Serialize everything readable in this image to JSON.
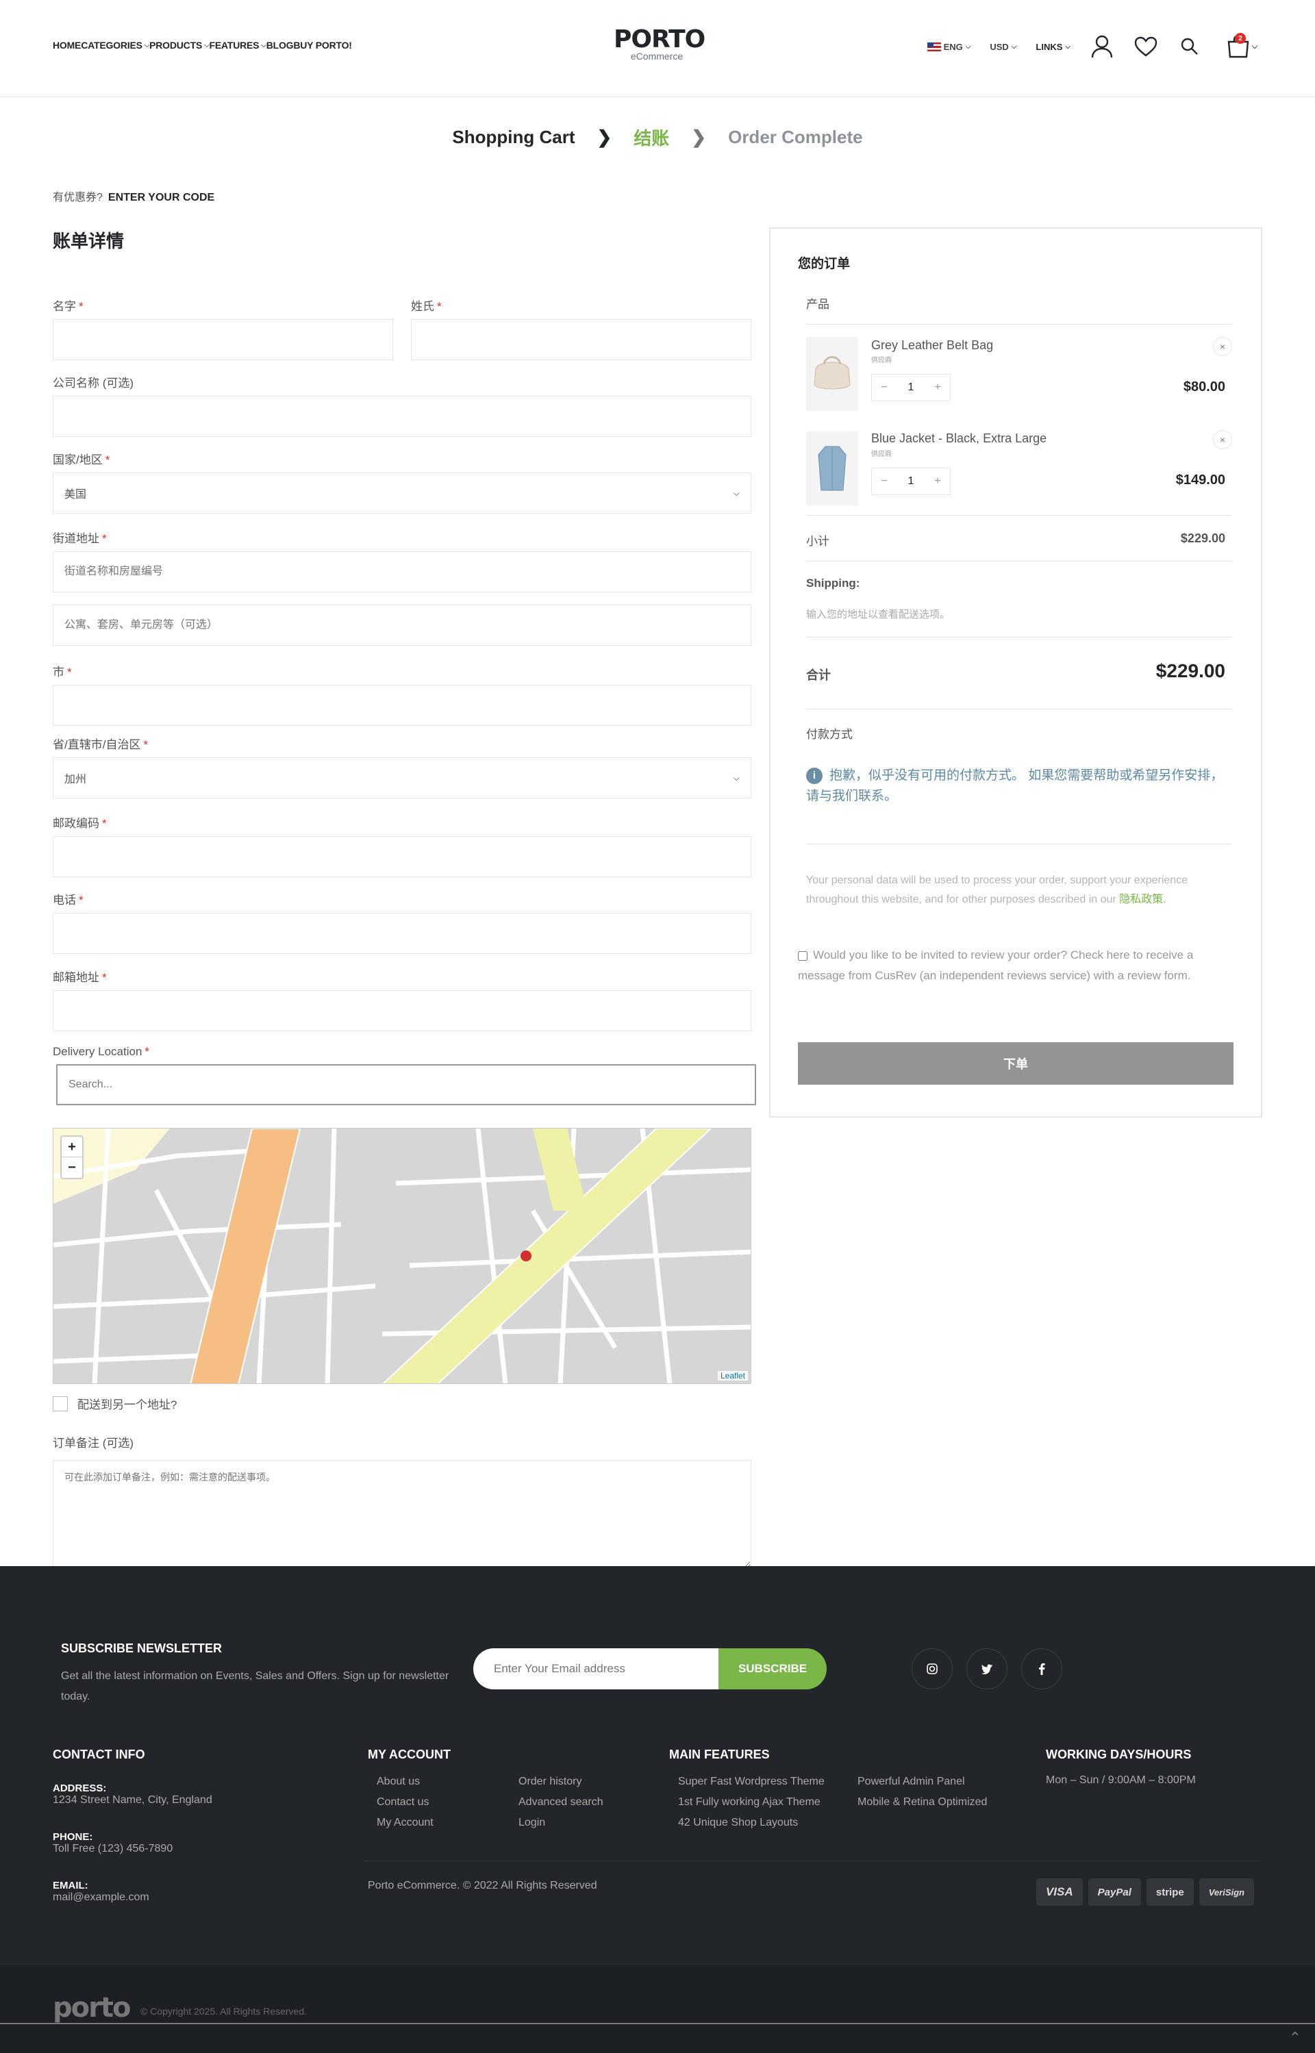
{
  "header": {
    "nav": [
      {
        "label": "HOME",
        "has_menu": false
      },
      {
        "label": "CATEGORIES",
        "has_menu": true
      },
      {
        "label": "PRODUCTS",
        "has_menu": true
      },
      {
        "label": "FEATURES",
        "has_menu": true
      },
      {
        "label": "BLOG",
        "has_menu": false
      },
      {
        "label": "BUY PORTO!",
        "has_menu": false
      }
    ],
    "logo_main": "PORTO",
    "logo_sub": "eCommerce",
    "language": "ENG",
    "currency": "USD",
    "links": "LINKS",
    "cart_count": "2"
  },
  "steps": {
    "cart": "Shopping Cart",
    "checkout": "结账",
    "complete": "Order Complete"
  },
  "coupon": {
    "question": "有优惠券?",
    "link": "ENTER YOUR CODE"
  },
  "billing": {
    "title": "账单详情",
    "first_name": "名字",
    "last_name": "姓氏",
    "company": "公司名称 (可选)",
    "country": "国家/地区",
    "country_value": "美国",
    "street": "街道地址",
    "street_placeholder": "街道名称和房屋编号",
    "street2_placeholder": "公寓、套房、单元房等（可选）",
    "city": "市",
    "state": "省/直辖市/自治区",
    "state_value": "加州",
    "postcode": "邮政编码",
    "phone": "电话",
    "email": "邮箱地址",
    "delivery": "Delivery Location",
    "search_placeholder": "Search...",
    "map_zoom_in": "+",
    "map_zoom_out": "−",
    "map_attribution": "Leaflet",
    "ship_different": "配送到另一个地址?",
    "notes_label": "订单备注 (可选)",
    "notes_placeholder": "可在此添加订单备注，例如：需注意的配送事项。",
    "req_mark": "*"
  },
  "order": {
    "title": "您的订单",
    "product_header": "产品",
    "items": [
      {
        "name": "Grey Leather Belt Bag",
        "vendor": "供应商",
        "qty": "1",
        "price": "$80.00"
      },
      {
        "name": "Blue Jacket - Black, Extra Large",
        "vendor": "供应商",
        "qty": "1",
        "price": "$149.00"
      }
    ],
    "subtotal_label": "小计",
    "subtotal": "$229.00",
    "shipping_label": "Shipping:",
    "shipping_note": "输入您的地址以查看配送选项。",
    "total_label": "合计",
    "total": "$229.00",
    "payment_label": "付款方式",
    "payment_notice": "抱歉，似乎没有可用的付款方式。 如果您需要帮助或希望另作安排，请与我们联系。",
    "privacy_text": "Your personal data will be used to process your order, support your experience throughout this website, and for other purposes described in our",
    "privacy_link": "隐私政策.",
    "review_text": "Would you like to be invited to review your order? Check here to receive a message from CusRev (an independent reviews service) with a review form.",
    "place_order": "下单"
  },
  "footer": {
    "newsletter_title": "SUBSCRIBE NEWSLETTER",
    "newsletter_desc": "Get all the latest information on Events, Sales and Offers. Sign up for newsletter today.",
    "email_placeholder": "Enter Your Email address",
    "subscribe": "SUBSCRIBE",
    "contact_title": "CONTACT INFO",
    "address_label": "ADDRESS:",
    "address": "1234 Street Name, City, England",
    "phone_label": "PHONE:",
    "phone": "Toll Free (123) 456-7890",
    "email_label": "EMAIL:",
    "email": "mail@example.com",
    "account_title": "MY ACCOUNT",
    "account_links_1": [
      "About us",
      "Contact us",
      "My Account"
    ],
    "account_links_2": [
      "Order history",
      "Advanced search",
      "Login"
    ],
    "features_title": "MAIN FEATURES",
    "features_1": [
      "Super Fast Wordpress Theme",
      "1st Fully working Ajax Theme",
      "42 Unique Shop Layouts"
    ],
    "features_2": [
      "Powerful Admin Panel",
      "Mobile & Retina Optimized"
    ],
    "hours_title": "WORKING DAYS/HOURS",
    "hours": "Mon – Sun / 9:00AM – 8:00PM",
    "copyright": "Porto eCommerce. © 2022 All Rights Reserved",
    "payments": [
      "VISA",
      "PayPal",
      "stripe",
      "VeriSign"
    ],
    "sub_logo": "porto",
    "sub_copyright": "© Copyright 2025. All Rights Reserved."
  }
}
